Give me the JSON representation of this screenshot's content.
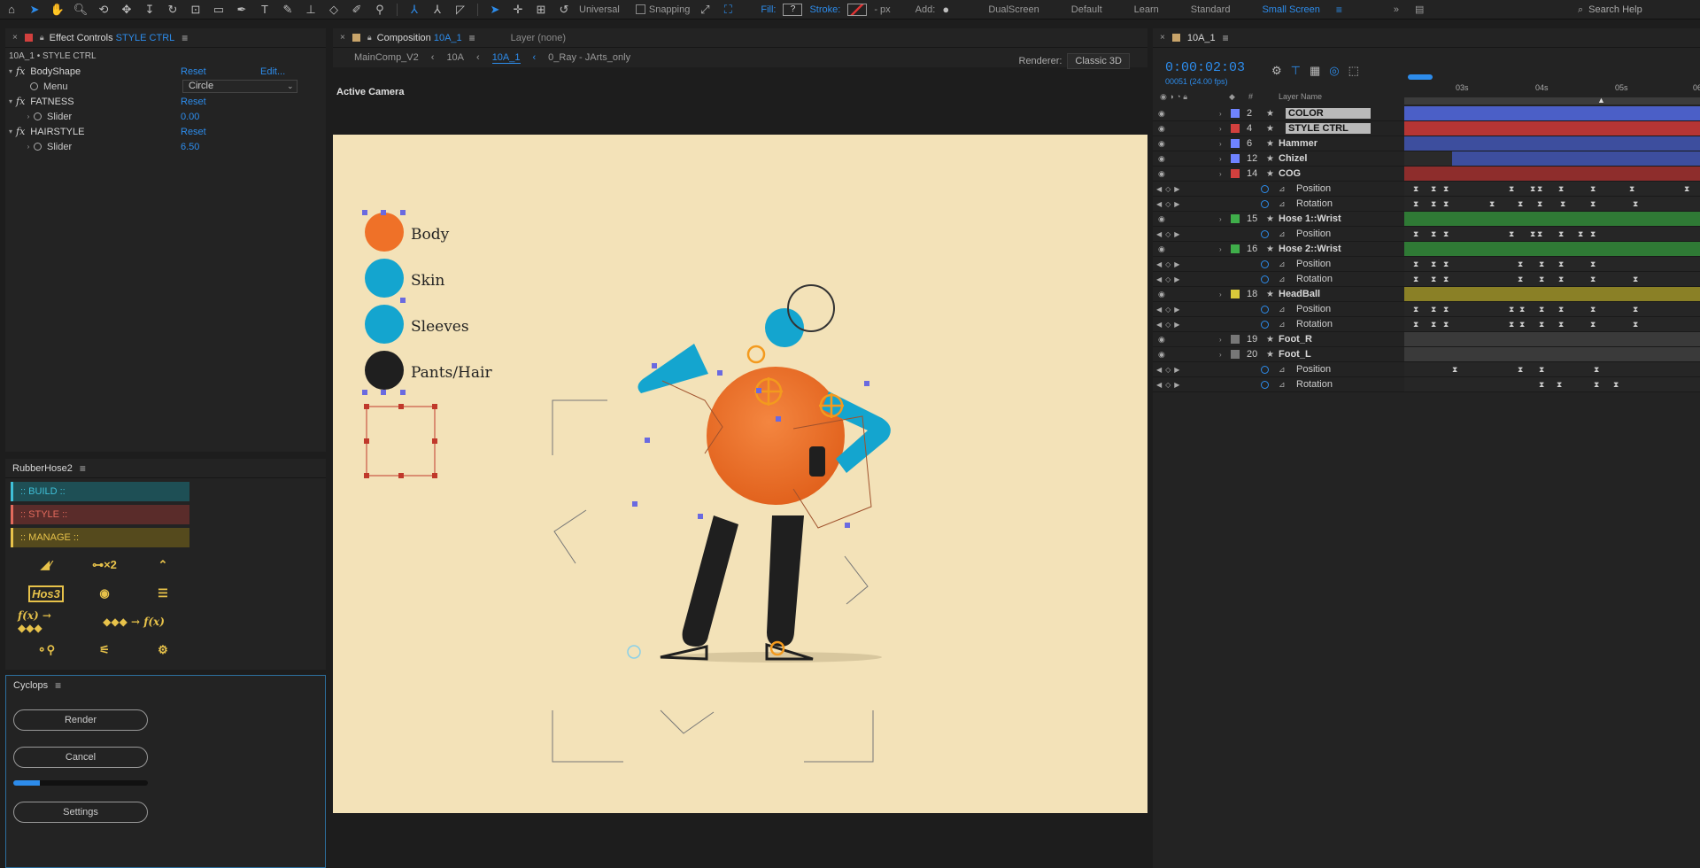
{
  "toolbar": {
    "universal": "Universal",
    "snapping": "Snapping",
    "fill_label": "Fill:",
    "fill_value": "?",
    "stroke_label": "Stroke:",
    "stroke_unit": "- px",
    "add_label": "Add:",
    "workspaces": [
      "DualScreen",
      "Default",
      "Learn",
      "Standard",
      "Small Screen"
    ],
    "current_workspace": "Small Screen",
    "search_placeholder": "Search Help"
  },
  "effect_controls": {
    "title": "Effect Controls",
    "layer": "STYLE CTRL",
    "subtitle": "10A_1 • STYLE CTRL",
    "effects": [
      {
        "name": "BodyShape",
        "reset": "Reset",
        "edit": "Edit...",
        "prop": "Menu",
        "value": "Circle"
      },
      {
        "name": "FATNESS",
        "reset": "Reset",
        "prop": "Slider",
        "value": "0.00"
      },
      {
        "name": "HAIRSTYLE",
        "reset": "Reset",
        "prop": "Slider",
        "value": "6.50"
      }
    ]
  },
  "rubberhose": {
    "title": "RubberHose2",
    "build": ":: BUILD ::",
    "style": ":: STYLE ::",
    "manage": ":: MANAGE ::",
    "hose_label": "Hos3",
    "expr_to_keys": "f(x) → ◆◆◆",
    "keys_to_expr": "◆◆◆ → f(x)"
  },
  "cyclops": {
    "title": "Cyclops",
    "render": "Render",
    "cancel": "Cancel",
    "settings": "Settings",
    "progress": 0.2
  },
  "composition": {
    "title": "Composition",
    "comp_name": "10A_1",
    "layer_label": "Layer",
    "layer_value": "(none)",
    "crumbs": [
      "MainComp_V2",
      "10A",
      "10A_1",
      "0_Ray - JArts_only"
    ],
    "current_crumb": "10A_1",
    "renderer_label": "Renderer:",
    "renderer_value": "Classic 3D",
    "camera": "Active Camera",
    "legend": [
      "Body",
      "Skin",
      "Sleeves",
      "Pants/Hair"
    ],
    "colors": {
      "orange": "#ef7128",
      "blue": "#14a5cf",
      "black": "#1f1f1f",
      "bg": "#f3e2b8"
    }
  },
  "timeline": {
    "comp_name": "10A_1",
    "timecode": "0:00:02:03",
    "fps": "00051 (24.00 fps)",
    "col_hash": "#",
    "col_name": "Layer Name",
    "ruler": [
      "03s",
      "04s",
      "05s",
      "06"
    ],
    "rows": [
      {
        "type": "layer",
        "num": "2",
        "name": "COLOR",
        "color": "#6f83ff",
        "sel": true,
        "bar": "#4b5fc7"
      },
      {
        "type": "layer",
        "num": "4",
        "name": "STYLE CTRL",
        "color": "#d2403e",
        "sel": true,
        "bar": "#b63534"
      },
      {
        "type": "layer",
        "num": "6",
        "name": "Hammer",
        "color": "#6f83ff",
        "bar": "#3d4e9e"
      },
      {
        "type": "layer",
        "num": "12",
        "name": "Chizel",
        "color": "#6f83ff",
        "bar": "#3d4e9e"
      },
      {
        "type": "layer",
        "num": "14",
        "name": "COG",
        "color": "#d2403e",
        "bar": "#8e2d2c"
      },
      {
        "type": "prop",
        "name": "Position"
      },
      {
        "type": "prop",
        "name": "Rotation"
      },
      {
        "type": "layer",
        "num": "15",
        "name": "Hose 1::Wrist",
        "color": "#3fae4a",
        "bar": "#2f7a35"
      },
      {
        "type": "prop",
        "name": "Position"
      },
      {
        "type": "layer",
        "num": "16",
        "name": "Hose 2::Wrist",
        "color": "#3fae4a",
        "bar": "#2f7a35"
      },
      {
        "type": "prop",
        "name": "Position"
      },
      {
        "type": "prop",
        "name": "Rotation"
      },
      {
        "type": "layer",
        "num": "18",
        "name": "HeadBall",
        "color": "#d9c93a",
        "bar": "#8a8026"
      },
      {
        "type": "prop",
        "name": "Position"
      },
      {
        "type": "prop",
        "name": "Rotation"
      },
      {
        "type": "layer",
        "num": "19",
        "name": "Foot_R",
        "color": "#777777",
        "bar": "#3a3a3a"
      },
      {
        "type": "layer",
        "num": "20",
        "name": "Foot_L",
        "color": "#777777",
        "bar": "#3a3a3a"
      },
      {
        "type": "prop",
        "name": "Position"
      },
      {
        "type": "prop",
        "name": "Rotation"
      }
    ]
  }
}
